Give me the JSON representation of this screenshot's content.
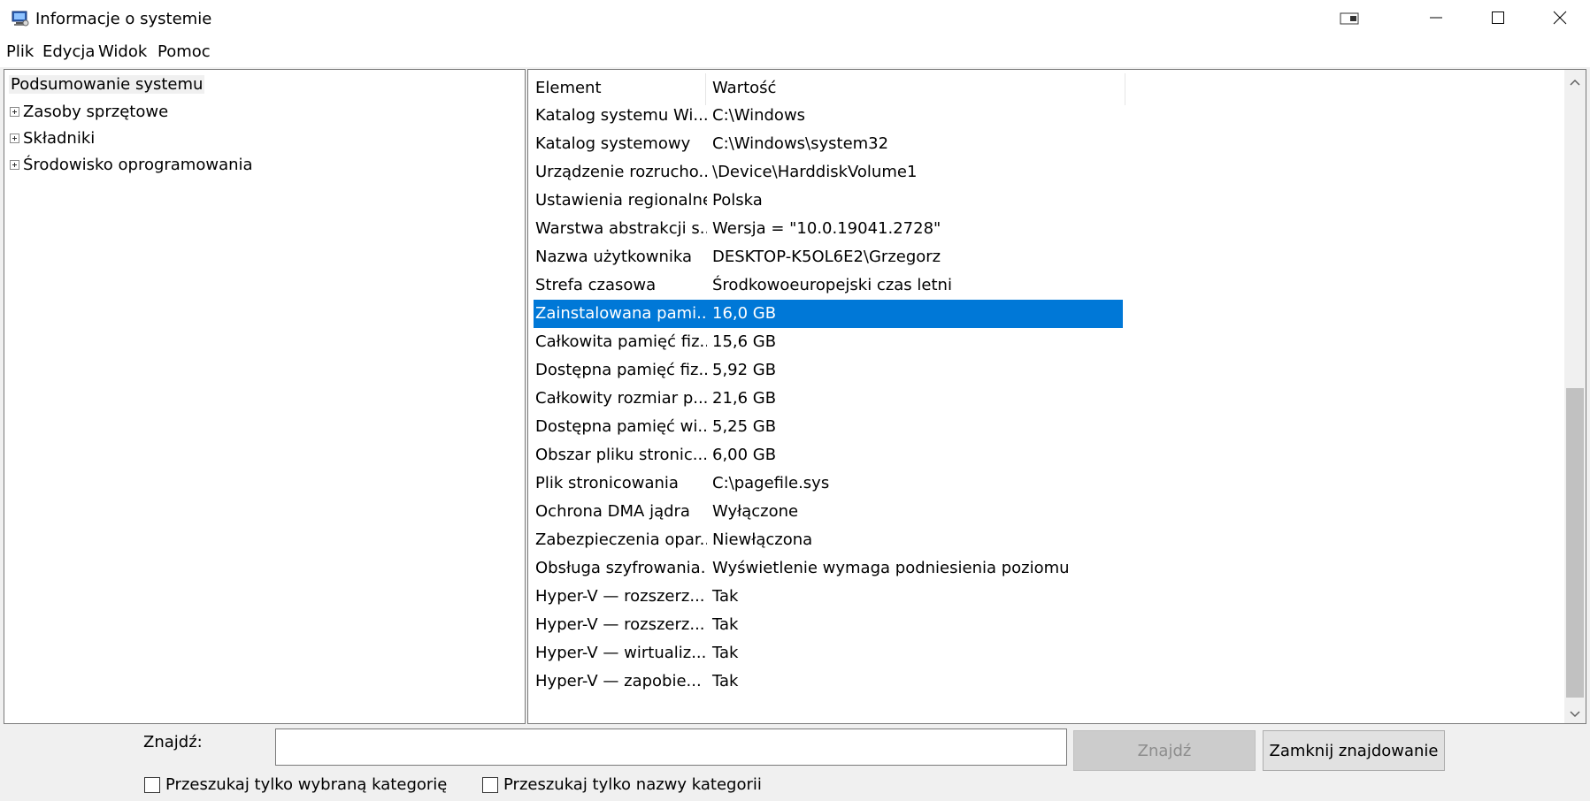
{
  "window": {
    "title": "Informacje o systemie",
    "icon": "system-info-icon",
    "accent_color": "#0078d7"
  },
  "menu": [
    "Plik",
    "Edycja",
    "Widok",
    "Pomoc"
  ],
  "tree": {
    "root": "Podsumowanie systemu",
    "nodes": [
      "Zasoby sprzętowe",
      "Składniki",
      "Środowisko oprogramowania"
    ]
  },
  "list": {
    "columns": [
      "Element",
      "Wartość"
    ],
    "rows": [
      {
        "element": "Katalog systemu Wi...",
        "value": "C:\\Windows"
      },
      {
        "element": "Katalog systemowy",
        "value": "C:\\Windows\\system32"
      },
      {
        "element": "Urządzenie rozrucho...",
        "value": "\\Device\\HarddiskVolume1"
      },
      {
        "element": "Ustawienia regionalne",
        "value": "Polska"
      },
      {
        "element": "Warstwa abstrakcji s...",
        "value": "Wersja = \"10.0.19041.2728\""
      },
      {
        "element": "Nazwa użytkownika",
        "value": "DESKTOP-K5OL6E2\\Grzegorz"
      },
      {
        "element": "Strefa czasowa",
        "value": "Środkowoeuropejski czas letni"
      },
      {
        "element": "Zainstalowana pami...",
        "value": "16,0 GB",
        "selected": true
      },
      {
        "element": "Całkowita pamięć fiz...",
        "value": "15,6 GB"
      },
      {
        "element": "Dostępna pamięć fiz...",
        "value": "5,92 GB"
      },
      {
        "element": "Całkowity rozmiar p...",
        "value": "21,6 GB"
      },
      {
        "element": "Dostępna pamięć wi...",
        "value": "5,25 GB"
      },
      {
        "element": "Obszar pliku stronic...",
        "value": "6,00 GB"
      },
      {
        "element": "Plik stronicowania",
        "value": "C:\\pagefile.sys"
      },
      {
        "element": "Ochrona DMA jądra",
        "value": "Wyłączone"
      },
      {
        "element": "Zabezpieczenia opar...",
        "value": "Niewłączona"
      },
      {
        "element": "Obsługa szyfrowania...",
        "value": "Wyświetlenie wymaga podniesienia poziomu"
      },
      {
        "element": "Hyper-V — rozszerz...",
        "value": "Tak"
      },
      {
        "element": "Hyper-V — rozszerz...",
        "value": "Tak"
      },
      {
        "element": "Hyper-V — wirtualiz...",
        "value": "Tak"
      },
      {
        "element": "Hyper-V — zapobie...",
        "value": "Tak"
      }
    ]
  },
  "find": {
    "label": "Znajdź:",
    "value": "",
    "find_button": "Znajdź",
    "close_button": "Zamknij znajdowanie",
    "check_selected_category": "Przeszukaj tylko wybraną kategorię",
    "check_category_names": "Przeszukaj tylko nazwy kategorii"
  }
}
